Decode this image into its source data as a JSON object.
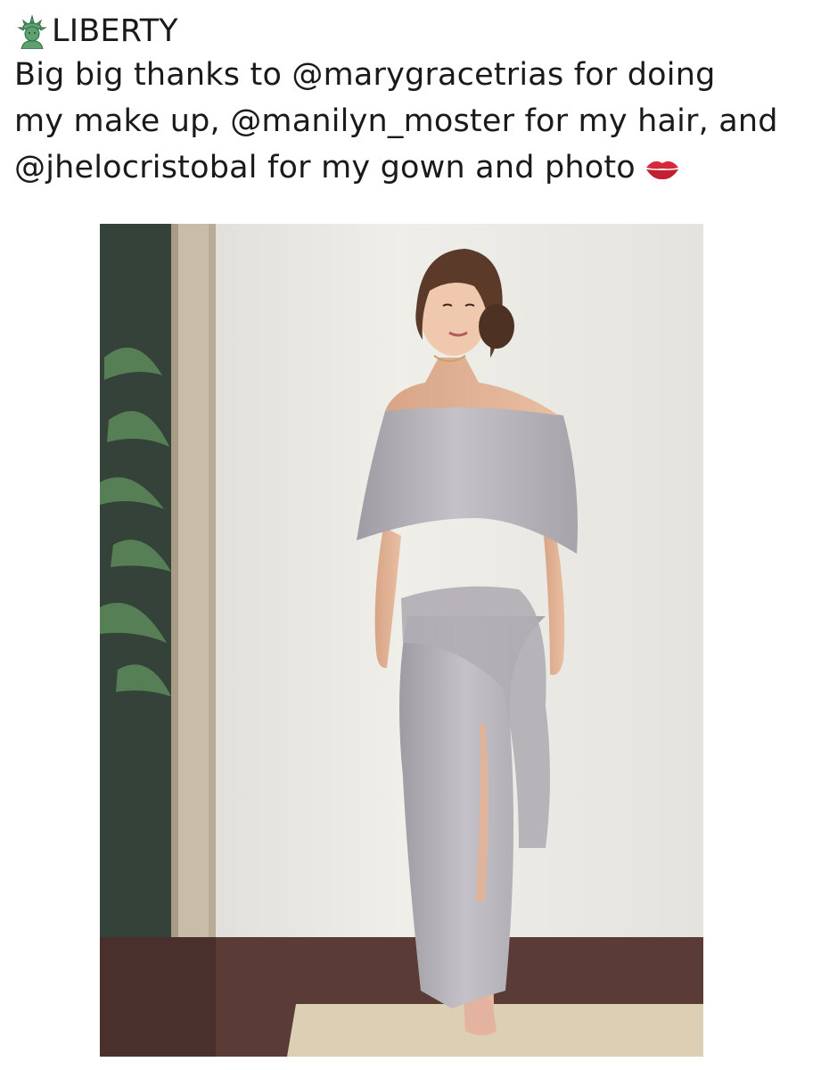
{
  "post": {
    "author": "LIBERTY",
    "author_icon": "statue-of-liberty-icon",
    "caption_lines": [
      "Big big thanks to @marygracetrias for doing",
      "my make up, @manilyn_moster for my hair, and",
      "@jhelocristobal for my gown and photo"
    ],
    "trailing_icon": "kiss-mark-icon"
  },
  "photo": {
    "subject": "woman-in-grey-off-shoulder-gown"
  },
  "colors": {
    "text": "#1a1a1a",
    "wall": "#ecebe6",
    "gown": "#b7b4ba",
    "floor": "#5b3b36",
    "lips": "#d5283b",
    "statue": "#5fa070"
  }
}
